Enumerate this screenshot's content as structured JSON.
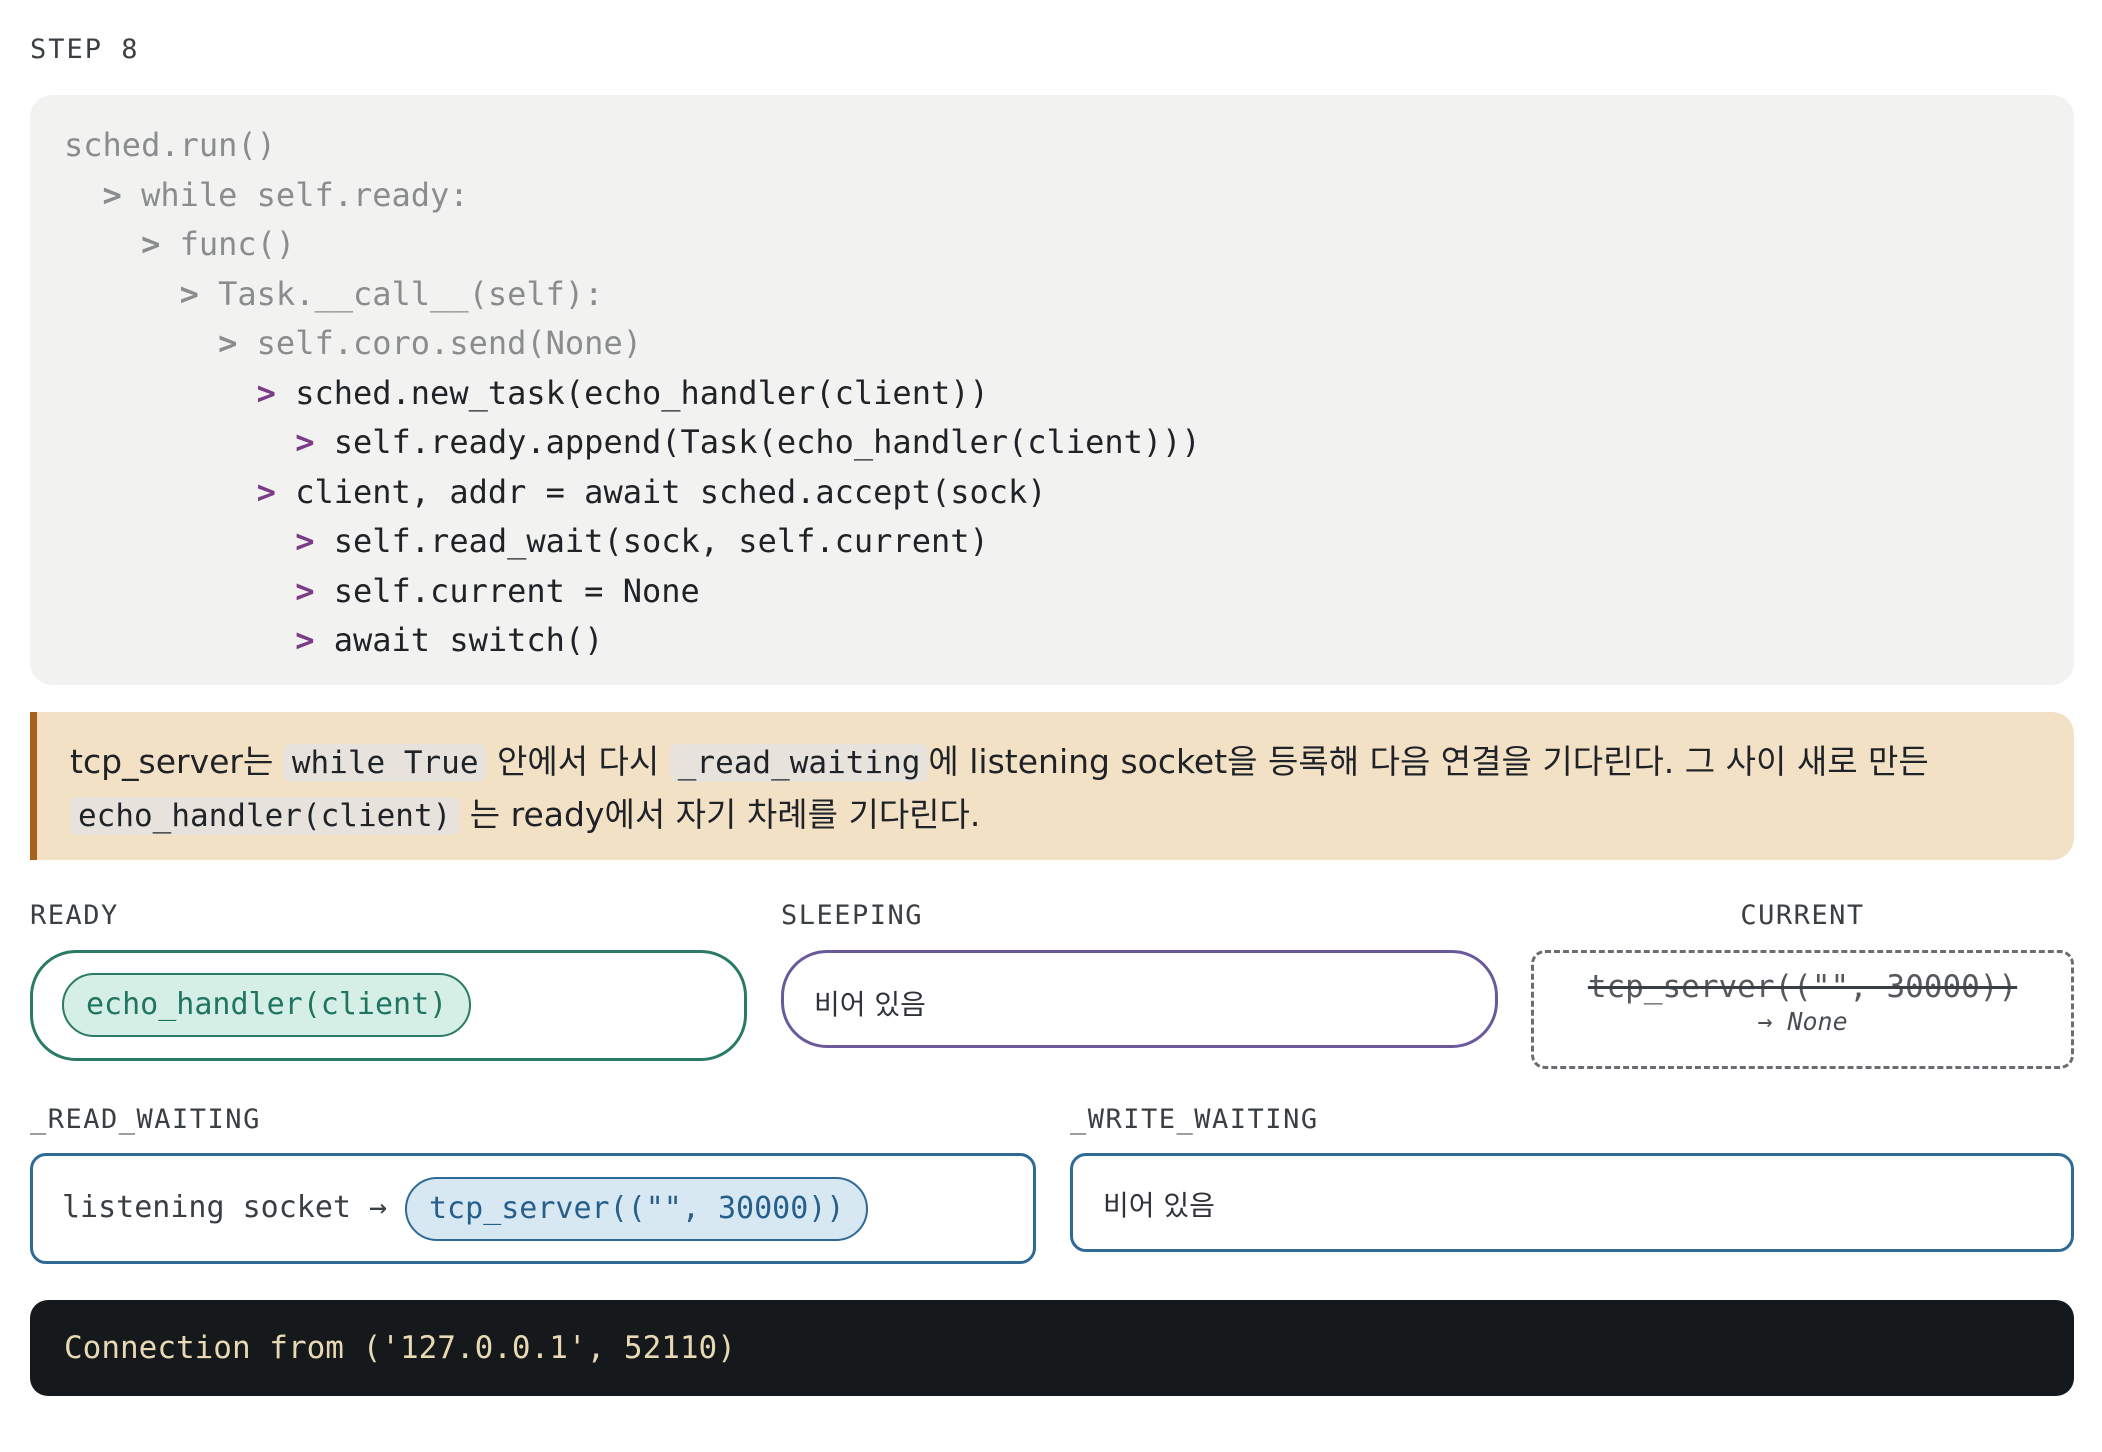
{
  "step": "STEP 8",
  "code": {
    "lines": [
      {
        "indent": "",
        "arrow": "",
        "text": "sched.run()",
        "dim": true
      },
      {
        "indent": "  ",
        "arrow": "> ",
        "text": "while self.ready:",
        "dim": true
      },
      {
        "indent": "    ",
        "arrow": "> ",
        "text": "func()",
        "dim": true
      },
      {
        "indent": "      ",
        "arrow": "> ",
        "text": "Task.__call__(self):",
        "dim": true
      },
      {
        "indent": "        ",
        "arrow": "> ",
        "text": "self.coro.send(None)",
        "dim": true
      },
      {
        "indent": "          ",
        "arrow": "> ",
        "text": "sched.new_task(echo_handler(client))",
        "dim": false
      },
      {
        "indent": "            ",
        "arrow": "> ",
        "text": "self.ready.append(Task(echo_handler(client)))",
        "dim": false
      },
      {
        "indent": "          ",
        "arrow": "> ",
        "text": "client, addr = await sched.accept(sock)",
        "dim": false
      },
      {
        "indent": "            ",
        "arrow": "> ",
        "text": "self.read_wait(sock, self.current)",
        "dim": false
      },
      {
        "indent": "            ",
        "arrow": "> ",
        "text": "self.current = None",
        "dim": false
      },
      {
        "indent": "            ",
        "arrow": "> ",
        "text": "await switch()",
        "dim": false
      }
    ]
  },
  "note": {
    "t1": "tcp_server는 ",
    "c1": "while True",
    "t2": " 안에서 다시 ",
    "c2": "_read_waiting",
    "t3": "에 listening socket을 등록해 다음 연결을 기다린다. 그 사이 새로 만든",
    "c3": "echo_handler(client)",
    "t4": " 는 ready에서 자기 차례를 기다린다."
  },
  "ready": {
    "label": "READY",
    "items": [
      "echo_handler(client)"
    ]
  },
  "sleeping": {
    "label": "SLEEPING",
    "empty_text": "비어 있음"
  },
  "current": {
    "label": "CURRENT",
    "old": "tcp_server((\"\", 30000))",
    "new": "→ None"
  },
  "read_waiting": {
    "label": "_READ_WAITING",
    "key": "listening socket →",
    "value": "tcp_server((\"\", 30000))"
  },
  "write_waiting": {
    "label": "_WRITE_WAITING",
    "empty_text": "비어 있음"
  },
  "terminal": {
    "output": "Connection from ('127.0.0.1', 52110)"
  }
}
